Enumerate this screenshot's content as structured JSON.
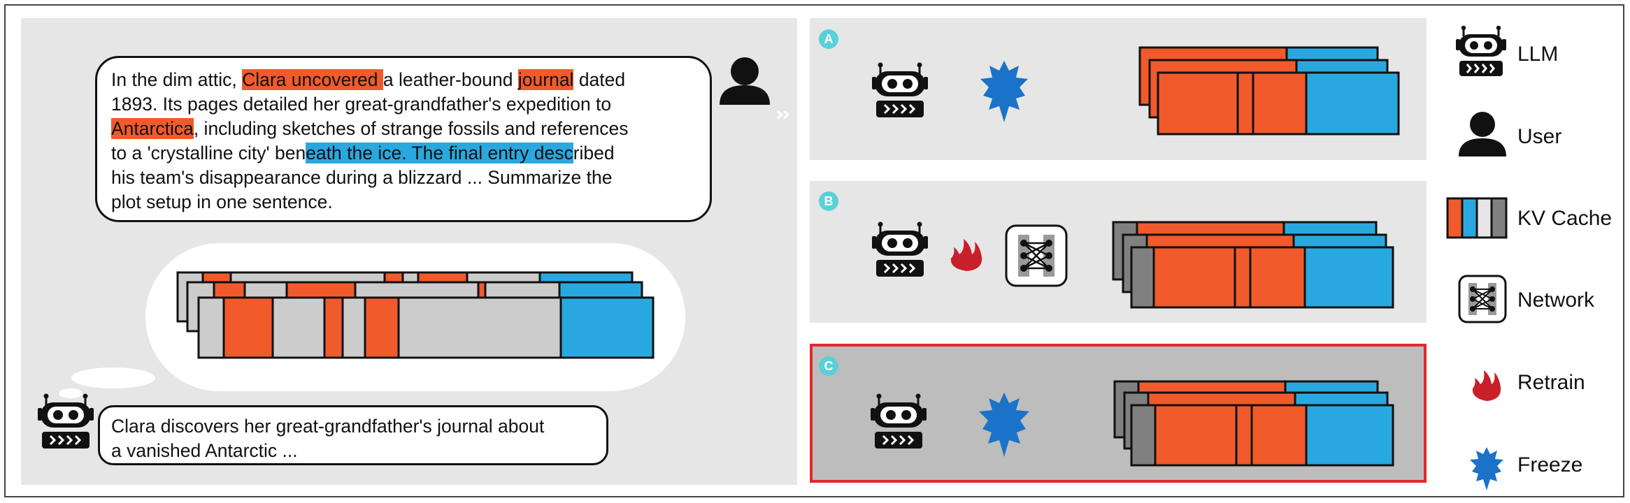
{
  "prompt": {
    "lines": [
      [
        {
          "t": "In the dim attic, ",
          "h": ""
        },
        {
          "t": "Clara uncovered ",
          "h": "o"
        },
        {
          "t": "a leather-bound ",
          "h": ""
        },
        {
          "t": "journal",
          "h": "o"
        },
        {
          "t": " dated",
          "h": ""
        }
      ],
      [
        {
          "t": "1893. Its pages detailed her great-grandfather's expedition to",
          "h": ""
        }
      ],
      [
        {
          "t": "Antarctica",
          "h": "o"
        },
        {
          "t": ", including sketches of strange fossils and references",
          "h": ""
        }
      ],
      [
        {
          "t": "to a 'crystalline city' ben",
          "h": ""
        },
        {
          "t": "eath the ice. The final entry desc",
          "h": "b"
        },
        {
          "t": "ribed",
          "h": ""
        }
      ],
      [
        {
          "t": "his team's disappearance during a blizzard ... Summarize the",
          "h": ""
        }
      ],
      [
        {
          "t": "plot setup in one sentence.",
          "h": ""
        }
      ]
    ]
  },
  "summary": {
    "line1": "Clara discovers her great-grandfather's journal about",
    "line2": "a vanished Antarctic ..."
  },
  "rows": {
    "a": {
      "label": "A"
    },
    "b": {
      "label": "B"
    },
    "c": {
      "label": "C"
    }
  },
  "legend": {
    "llm": "LLM",
    "user": "User",
    "kv_cache": "KV Cache",
    "network": "Network",
    "retrain": "Retrain",
    "freeze": "Freeze"
  },
  "colors": {
    "orange": "#f15a2b",
    "blue": "#29a8e0",
    "light_gray": "#cccccc",
    "dark_gray": "#808080",
    "highlight_border": "#e02a2f",
    "badge": "#5ad0d8",
    "fire": "#c8202a",
    "snowflake": "#1a73c8"
  }
}
